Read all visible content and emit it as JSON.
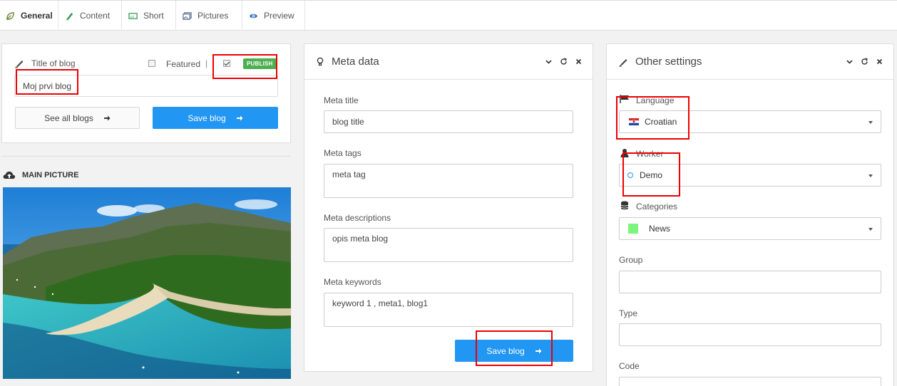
{
  "tabs": [
    {
      "label": "General",
      "icon": "leaf-icon",
      "active": true
    },
    {
      "label": "Content",
      "icon": "pen-icon",
      "active": false
    },
    {
      "label": "Short",
      "icon": "cc-icon",
      "active": false
    },
    {
      "label": "Pictures",
      "icon": "images-icon",
      "active": false
    },
    {
      "label": "Preview",
      "icon": "eye-icon",
      "active": false
    }
  ],
  "blog": {
    "title_label": "Title of blog",
    "featured_label": "Featured",
    "separator": "|",
    "featured_checked": false,
    "publish_checked": true,
    "publish_badge": "PUBLISH",
    "title_value": "Moj prvi blog",
    "see_all_label": "See all blogs",
    "save_label": "Save blog",
    "main_picture_label": "MAIN PICTURE"
  },
  "meta": {
    "title": "Meta data",
    "meta_title_label": "Meta title",
    "meta_title_value": "blog title",
    "meta_tags_label": "Meta tags",
    "meta_tags_value": "meta tag",
    "meta_desc_label": "Meta descriptions",
    "meta_desc_value": "opis meta blog",
    "meta_keywords_label": "Meta keywords",
    "meta_keywords_value": "keyword 1 , meta1, blog1",
    "save_label": "Save blog"
  },
  "other": {
    "title": "Other settings",
    "language_label": "Language",
    "language_value": "Croatian",
    "worker_label": "Worker",
    "worker_value": "Demo",
    "categories_label": "Categories",
    "categories_value": "News",
    "category_color": "#7cf57c",
    "group_label": "Group",
    "group_value": "",
    "type_label": "Type",
    "type_value": "",
    "code_label": "Code",
    "code_value": ""
  },
  "colors": {
    "primary": "#2196f3",
    "publish": "#4caf50",
    "highlight": "#e00000"
  }
}
